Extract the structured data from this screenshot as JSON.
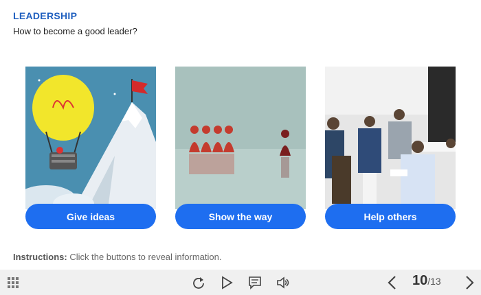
{
  "header": {
    "title": "LEADERSHIP",
    "subtitle": "How to become a good leader?"
  },
  "cards": [
    {
      "image": "lightbulb-balloon-mountain-flag-illustration",
      "label": "Give ideas"
    },
    {
      "image": "red-pawns-leader-piece-illustration",
      "label": "Show the way"
    },
    {
      "image": "business-team-meeting-photo",
      "label": "Help others"
    }
  ],
  "instructions": {
    "prefix": "Instructions:",
    "text": " Click the buttons to reveal information."
  },
  "player": {
    "current_page": "10",
    "total_pages": "/13",
    "icons": [
      "menu-grid-icon",
      "replay-icon",
      "play-icon",
      "captions-icon",
      "volume-icon",
      "prev-icon",
      "next-icon"
    ]
  },
  "colors": {
    "accent": "#1e6ef0",
    "title": "#1f5fbf",
    "bar": "#f0f0f0"
  }
}
